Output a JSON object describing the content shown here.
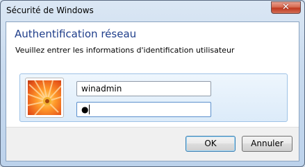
{
  "window": {
    "title": "Sécurité de Windows"
  },
  "close": {
    "glyph": "✕",
    "icon": "close-icon"
  },
  "dialog": {
    "heading": "Authentification réseau",
    "subheading": "Veuillez entrer les informations d'identification utilisateur"
  },
  "credentials": {
    "avatar_icon": "user-picture-flower-icon",
    "username": "winadmin",
    "password_mask": "●"
  },
  "buttons": {
    "ok": "OK",
    "cancel": "Annuler"
  },
  "colors": {
    "heading": "#1e3d8a",
    "close_button": "#c0391f",
    "tile_background": "#dcebf9"
  }
}
